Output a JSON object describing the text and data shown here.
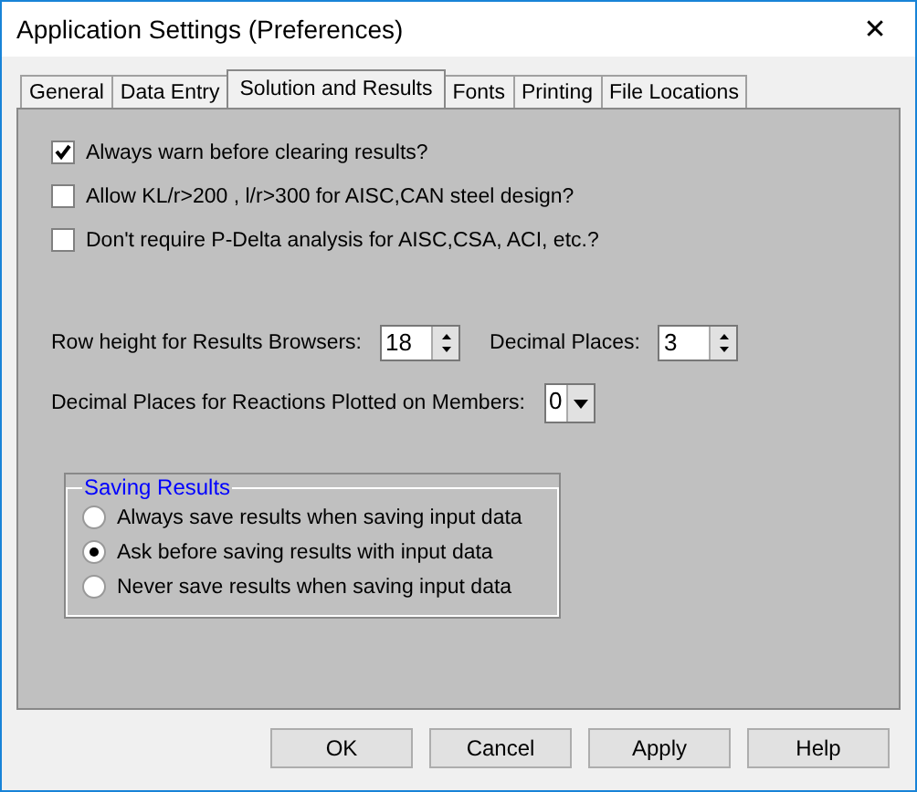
{
  "window": {
    "title": "Application Settings (Preferences)",
    "close": "✕"
  },
  "tabs": [
    {
      "label": "General",
      "selected": false
    },
    {
      "label": "Data Entry",
      "selected": false
    },
    {
      "label": "Solution and Results",
      "selected": true
    },
    {
      "label": "Fonts",
      "selected": false
    },
    {
      "label": "Printing",
      "selected": false
    },
    {
      "label": "File Locations",
      "selected": false
    }
  ],
  "checkboxes": [
    {
      "label": "Always warn before clearing results?",
      "checked": true
    },
    {
      "label": "Allow KL/r>200 , l/r>300 for AISC,CAN steel design?",
      "checked": false
    },
    {
      "label": "Don't require P-Delta analysis for AISC,CSA, ACI, etc.?",
      "checked": false
    }
  ],
  "row_height": {
    "label": "Row height for Results Browsers:",
    "value": "18"
  },
  "decimal_places": {
    "label": "Decimal Places:",
    "value": "3"
  },
  "reaction_decimals": {
    "label": "Decimal Places for Reactions Plotted on Members:",
    "value": "0"
  },
  "saving_results": {
    "title": "Saving Results",
    "options": [
      {
        "label": "Always save results when saving input data",
        "selected": false
      },
      {
        "label": "Ask before saving results with input data",
        "selected": true
      },
      {
        "label": "Never save results when saving input data",
        "selected": false
      }
    ]
  },
  "buttons": [
    "OK",
    "Cancel",
    "Apply",
    "Help"
  ]
}
